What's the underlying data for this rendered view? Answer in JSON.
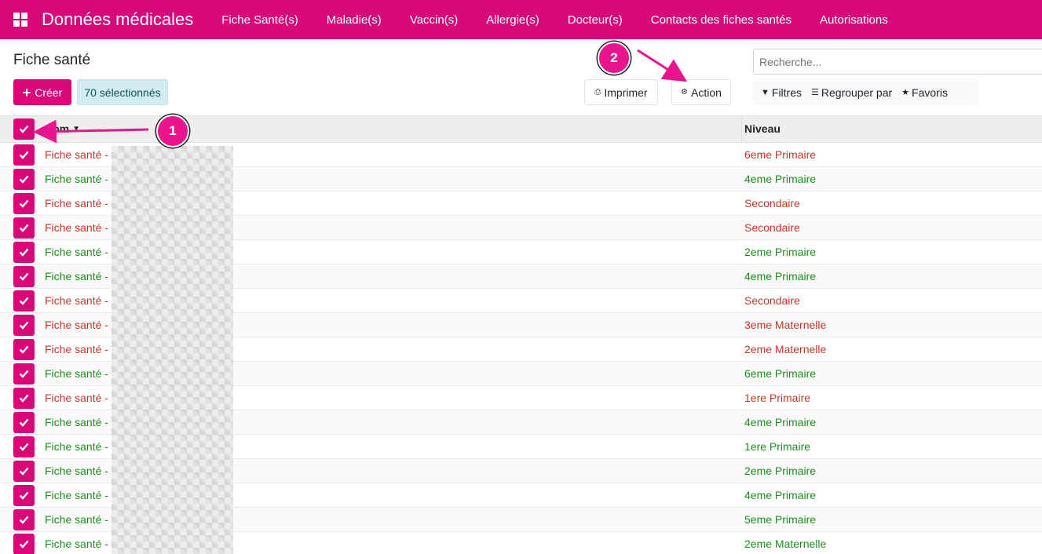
{
  "navbar": {
    "brand": "Données médicales",
    "menu": [
      "Fiche Santé(s)",
      "Maladie(s)",
      "Vaccin(s)",
      "Allergie(s)",
      "Docteur(s)",
      "Contacts des fiches santés",
      "Autorisations"
    ],
    "color": "#d6087a"
  },
  "control": {
    "title": "Fiche santé",
    "create_label": "Créer",
    "selected_label": "70 sélectionnés",
    "print_label": "Imprimer",
    "action_label": "Action",
    "search_placeholder": "Recherche...",
    "filters_label": "Filtres",
    "groupby_label": "Regrouper par",
    "favorites_label": "Favoris"
  },
  "table": {
    "col_nom": "Nom",
    "col_niveau": "Niveau",
    "rows": [
      {
        "nom": "Fiche santé -",
        "niveau": "6eme Primaire",
        "status": "red"
      },
      {
        "nom": "Fiche santé -",
        "niveau": "4eme Primaire",
        "status": "green"
      },
      {
        "nom": "Fiche santé -",
        "niveau": "Secondaire",
        "status": "red"
      },
      {
        "nom": "Fiche santé -",
        "niveau": "Secondaire",
        "status": "red"
      },
      {
        "nom": "Fiche santé -",
        "niveau": "2eme Primaire",
        "status": "green"
      },
      {
        "nom": "Fiche santé -",
        "niveau": "4eme Primaire",
        "status": "green"
      },
      {
        "nom": "Fiche santé -",
        "niveau": "Secondaire",
        "status": "red"
      },
      {
        "nom": "Fiche santé -",
        "niveau": "3eme Maternelle",
        "status": "red"
      },
      {
        "nom": "Fiche santé -",
        "niveau": "2eme Maternelle",
        "status": "red"
      },
      {
        "nom": "Fiche santé -",
        "niveau": "6eme Primaire",
        "status": "green"
      },
      {
        "nom": "Fiche santé -",
        "niveau": "1ere Primaire",
        "status": "red"
      },
      {
        "nom": "Fiche santé -",
        "niveau": "4eme Primaire",
        "status": "green"
      },
      {
        "nom": "Fiche santé -",
        "niveau": "1ere Primaire",
        "status": "green"
      },
      {
        "nom": "Fiche santé -",
        "niveau": "2eme Primaire",
        "status": "green"
      },
      {
        "nom": "Fiche santé -",
        "niveau": "4eme Primaire",
        "status": "green"
      },
      {
        "nom": "Fiche santé -",
        "niveau": "5eme Primaire",
        "status": "green"
      },
      {
        "nom": "Fiche santé -",
        "niveau": "2eme Maternelle",
        "status": "green"
      }
    ]
  },
  "annotations": {
    "one": "1",
    "two": "2"
  },
  "icons": {
    "apps": "apps-grid-icon",
    "check": "check-icon",
    "filter": "funnel-icon",
    "group": "bars-icon",
    "star": "star-icon",
    "print": "printer-icon",
    "gear": "gear-icon"
  }
}
